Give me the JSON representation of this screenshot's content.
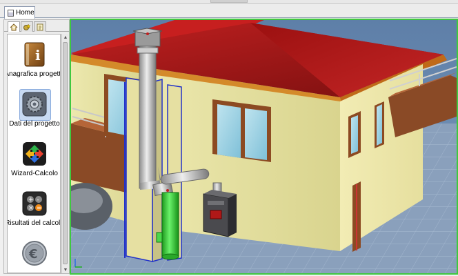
{
  "tabs": {
    "home_label": "Home"
  },
  "sidebar": {
    "tabs": [
      {
        "icon": "home-icon"
      },
      {
        "icon": "gear-star-icon"
      },
      {
        "icon": "notepad-icon"
      }
    ],
    "items": [
      {
        "label": "Anagrafica progetto",
        "icon": "info-book-icon"
      },
      {
        "label": "Dati del progetto",
        "icon": "settings-gear-icon"
      },
      {
        "label": "Wizard-Calcolo",
        "icon": "wizard-arrows-icon"
      },
      {
        "label": "Risultati del calcolo",
        "icon": "calculator-icon"
      },
      {
        "label": "",
        "icon": "euro-coin-icon"
      }
    ]
  },
  "viewport": {
    "scene": "3D house with flue chimney",
    "accent": "#3fc83f"
  }
}
